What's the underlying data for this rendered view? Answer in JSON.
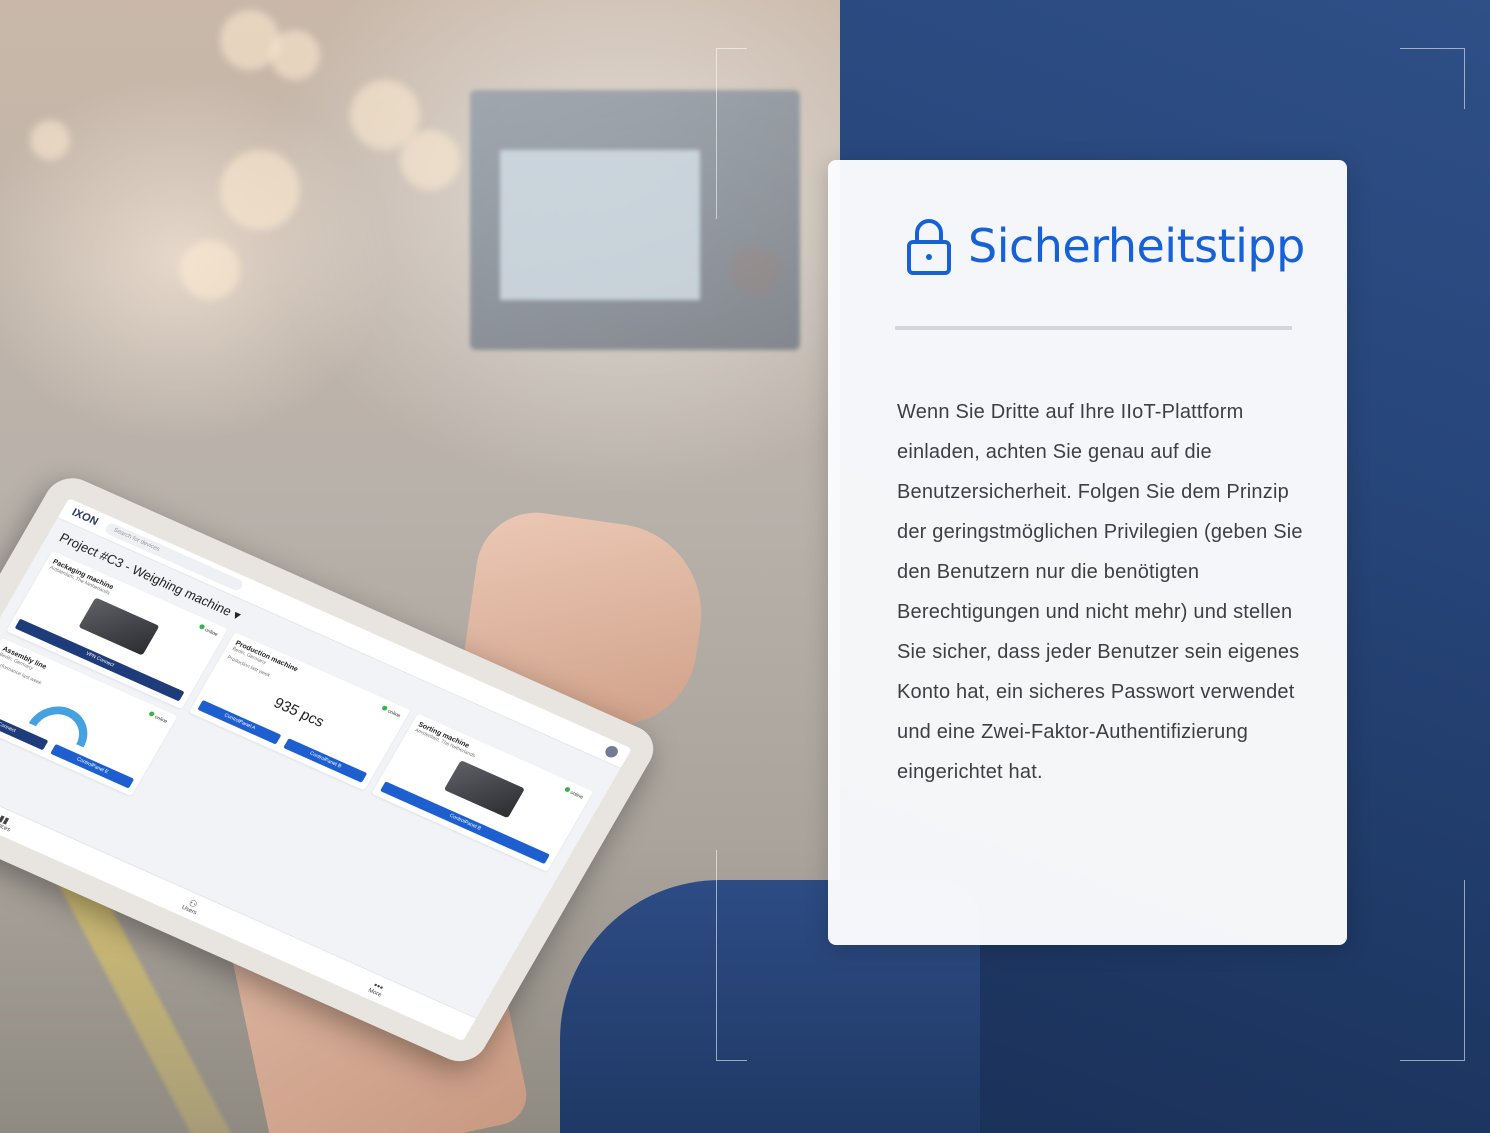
{
  "card": {
    "title": "Sicherheitstipp",
    "icon": "lock-icon",
    "accent_color": "#1660d8",
    "body": "Wenn Sie Dritte auf Ihre IIoT-Plattform einladen, achten Sie genau auf die Benutzersicherheit. Folgen Sie dem Prinzip der geringstmöglichen Privilegien (geben Sie den Benutzern nur die benötigten Berechtigungen und nicht mehr) und stellen Sie sicher, dass jeder Benutzer sein eigenes Konto hat, ein sicheres Passwort verwendet und eine Zwei-Faktor-Authentifizierung eingerichtet hat."
  },
  "tablet": {
    "logo": "IXON",
    "search_placeholder": "Search for devices",
    "project_title": "Project #C3 - Weighing machine ▾",
    "cards": [
      {
        "title": "Packaging machine",
        "subtitle": "Amsterdam, The Netherlands",
        "status": "online",
        "button": "VPN Connect",
        "button_style": "dark"
      },
      {
        "title": "Production machine",
        "subtitle": "Berlin, Germany",
        "status": "online",
        "metric_label": "Production last week",
        "metric_value": "935 pcs",
        "buttons": [
          "ControlPanel A",
          "ControlPanel B"
        ]
      },
      {
        "title": "Sorting machine",
        "subtitle": "Amsterdam, The Netherlands",
        "status": "online",
        "button": "ControlPanel B"
      },
      {
        "title": "Assembly line",
        "subtitle": "Berlin, Germany",
        "status": "online",
        "metric_label": "Performance last week",
        "buttons": [
          "Connect",
          "ControlPanel E"
        ]
      }
    ],
    "nav": [
      {
        "label": "Devices",
        "icon": "devices-icon"
      },
      {
        "label": "Users",
        "icon": "users-icon"
      },
      {
        "label": "More",
        "icon": "more-icon"
      }
    ]
  }
}
